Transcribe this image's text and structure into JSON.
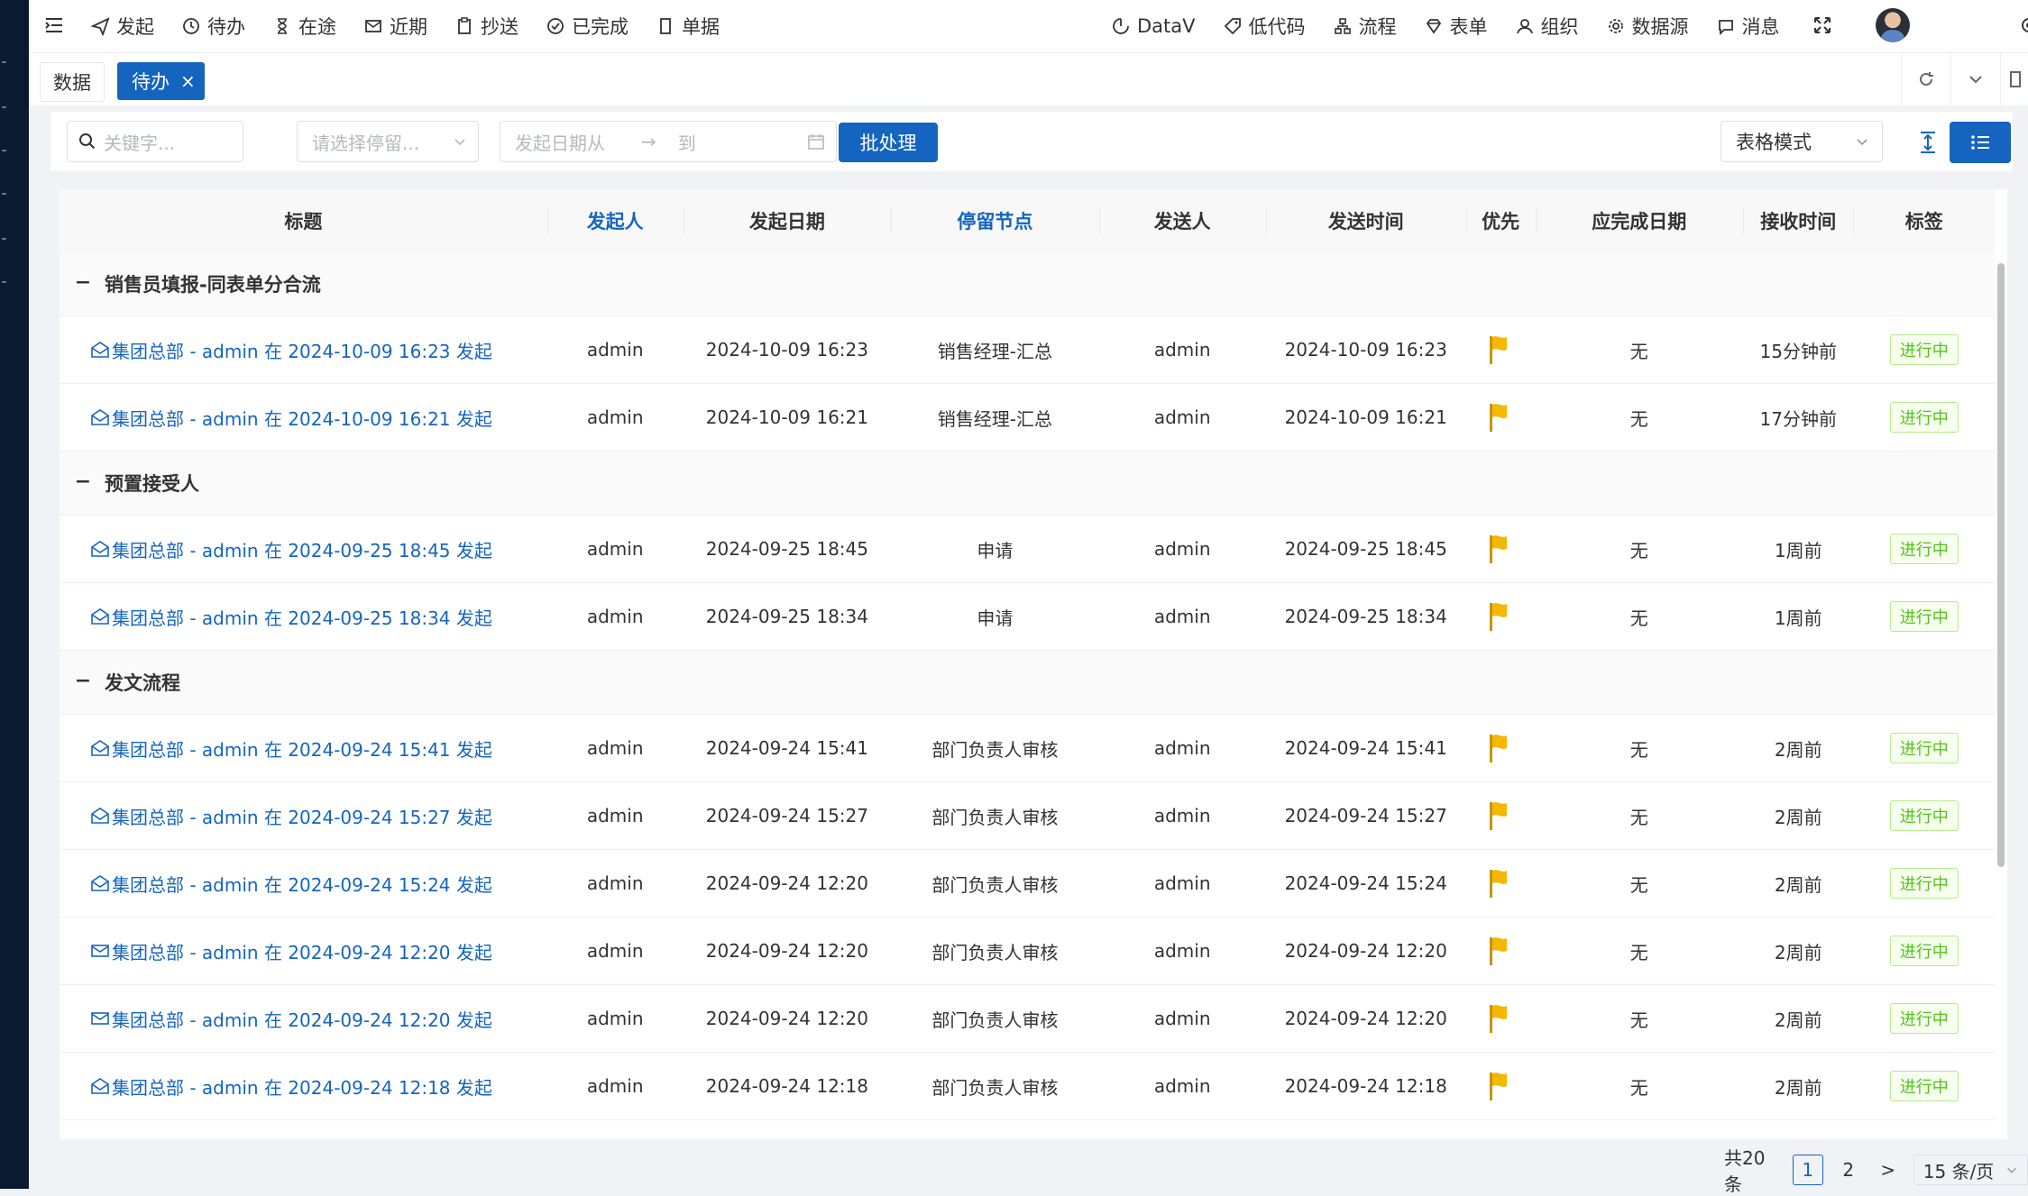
{
  "topnav": {
    "left": [
      {
        "label": "发起",
        "icon": "send-icon"
      },
      {
        "label": "待办",
        "icon": "clock-icon"
      },
      {
        "label": "在途",
        "icon": "hourglass-icon"
      },
      {
        "label": "近期",
        "icon": "mail-icon"
      },
      {
        "label": "抄送",
        "icon": "clipboard-icon"
      },
      {
        "label": "已完成",
        "icon": "check-circle-icon"
      },
      {
        "label": "单据",
        "icon": "document-icon"
      }
    ],
    "right": [
      {
        "label": "DataV",
        "icon": "dashboard-icon"
      },
      {
        "label": "低代码",
        "icon": "tag-icon"
      },
      {
        "label": "流程",
        "icon": "flow-icon"
      },
      {
        "label": "表单",
        "icon": "diamond-icon"
      },
      {
        "label": "组织",
        "icon": "users-icon"
      },
      {
        "label": "数据源",
        "icon": "gear-icon"
      },
      {
        "label": "消息",
        "icon": "message-icon"
      }
    ]
  },
  "tabs": [
    {
      "label": "数据"
    },
    {
      "label": "待办",
      "close": "×"
    }
  ],
  "filters": {
    "keyword_placeholder": "关键字...",
    "node_placeholder": "请选择停留...",
    "date_from_placeholder": "发起日期从",
    "date_arrow": "→",
    "date_to_placeholder": "到",
    "batch_label": "批处理",
    "mode_value": "表格模式"
  },
  "columns": [
    "标题",
    "发起人",
    "发起日期",
    "停留节点",
    "发送人",
    "发送时间",
    "优先",
    "应完成日期",
    "接收时间",
    "标签"
  ],
  "groups": [
    {
      "title": "销售员填报-同表单分合流",
      "toggle": "−",
      "rows": [
        {
          "title": "集团总部 - admin 在 2024-10-09 16:23 发起",
          "read": true,
          "starter": "admin",
          "start_date": "2024-10-09 16:23",
          "node": "销售经理-汇总",
          "sender": "admin",
          "send_time": "2024-10-09 16:23",
          "due": "无",
          "received": "15分钟前",
          "tag": "进行中"
        },
        {
          "title": "集团总部 - admin 在 2024-10-09 16:21 发起",
          "read": true,
          "starter": "admin",
          "start_date": "2024-10-09 16:21",
          "node": "销售经理-汇总",
          "sender": "admin",
          "send_time": "2024-10-09 16:21",
          "due": "无",
          "received": "17分钟前",
          "tag": "进行中"
        }
      ]
    },
    {
      "title": "预置接受人",
      "toggle": "−",
      "rows": [
        {
          "title": "集团总部 - admin 在 2024-09-25 18:45 发起",
          "read": true,
          "starter": "admin",
          "start_date": "2024-09-25 18:45",
          "node": "申请",
          "sender": "admin",
          "send_time": "2024-09-25 18:45",
          "due": "无",
          "received": "1周前",
          "tag": "进行中"
        },
        {
          "title": "集团总部 - admin 在 2024-09-25 18:34 发起",
          "read": true,
          "starter": "admin",
          "start_date": "2024-09-25 18:34",
          "node": "申请",
          "sender": "admin",
          "send_time": "2024-09-25 18:34",
          "due": "无",
          "received": "1周前",
          "tag": "进行中"
        }
      ]
    },
    {
      "title": "发文流程",
      "toggle": "−",
      "rows": [
        {
          "title": "集团总部 - admin 在 2024-09-24 15:41 发起",
          "read": true,
          "starter": "admin",
          "start_date": "2024-09-24 15:41",
          "node": "部门负责人审核",
          "sender": "admin",
          "send_time": "2024-09-24 15:41",
          "due": "无",
          "received": "2周前",
          "tag": "进行中"
        },
        {
          "title": "集团总部 - admin 在 2024-09-24 15:27 发起",
          "read": true,
          "starter": "admin",
          "start_date": "2024-09-24 15:27",
          "node": "部门负责人审核",
          "sender": "admin",
          "send_time": "2024-09-24 15:27",
          "due": "无",
          "received": "2周前",
          "tag": "进行中"
        },
        {
          "title": "集团总部 - admin 在 2024-09-24 15:24 发起",
          "read": true,
          "starter": "admin",
          "start_date": "2024-09-24 12:20",
          "node": "部门负责人审核",
          "sender": "admin",
          "send_time": "2024-09-24 15:24",
          "due": "无",
          "received": "2周前",
          "tag": "进行中"
        },
        {
          "title": "集团总部 - admin 在 2024-09-24 12:20 发起",
          "read": false,
          "starter": "admin",
          "start_date": "2024-09-24 12:20",
          "node": "部门负责人审核",
          "sender": "admin",
          "send_time": "2024-09-24 12:20",
          "due": "无",
          "received": "2周前",
          "tag": "进行中"
        },
        {
          "title": "集团总部 - admin 在 2024-09-24 12:20 发起",
          "read": false,
          "starter": "admin",
          "start_date": "2024-09-24 12:20",
          "node": "部门负责人审核",
          "sender": "admin",
          "send_time": "2024-09-24 12:20",
          "due": "无",
          "received": "2周前",
          "tag": "进行中"
        },
        {
          "title": "集团总部 - admin 在 2024-09-24 12:18 发起",
          "read": true,
          "starter": "admin",
          "start_date": "2024-09-24 12:18",
          "node": "部门负责人审核",
          "sender": "admin",
          "send_time": "2024-09-24 12:18",
          "due": "无",
          "received": "2周前",
          "tag": "进行中"
        }
      ]
    }
  ],
  "pagination": {
    "total": "共20条",
    "pages": [
      "1",
      "2"
    ],
    "current": "1",
    "next": ">",
    "page_size": "15 条/页"
  },
  "colors": {
    "primary": "#1565c0",
    "sidebar": "#0b1a2e",
    "flag": "#f5b800",
    "tag_green": "#52c41a"
  }
}
